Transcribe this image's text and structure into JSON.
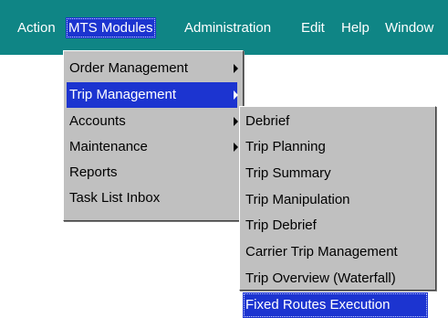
{
  "menubar": {
    "items": [
      "Action",
      "MTS Modules",
      "Administration",
      "Edit",
      "Help",
      "Window"
    ],
    "active": "MTS Modules"
  },
  "mts_menu": {
    "items": [
      "Order Management",
      "Trip Management",
      "Accounts",
      "Maintenance",
      "Reports",
      "Task List Inbox"
    ],
    "highlighted": "Trip Management"
  },
  "trip_menu": {
    "items": [
      "Debrief",
      "Trip Planning",
      "Trip Summary",
      "Trip Manipulation",
      "Trip Debrief",
      "Carrier Trip Management",
      "Trip Overview (Waterfall)",
      "Fixed Routes Execution"
    ],
    "highlighted": "Fixed Routes Execution"
  },
  "colors": {
    "menubar_bg": "#0f8585",
    "menu_bg": "#c0c0c0",
    "highlight": "#1c34d0",
    "text": "#000000",
    "menubar_text": "#ffffff"
  }
}
